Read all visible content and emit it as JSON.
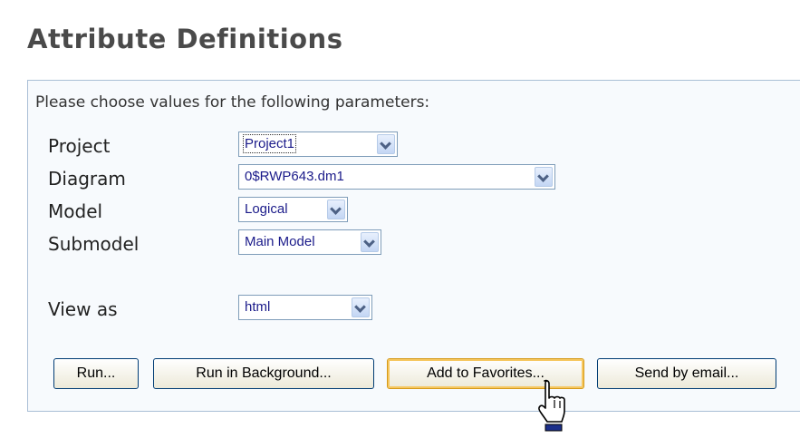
{
  "page": {
    "title": "Attribute Definitions"
  },
  "form": {
    "intro": "Please choose values for the following parameters:",
    "fields": {
      "project": {
        "label": "Project",
        "value": "Project1"
      },
      "diagram": {
        "label": "Diagram",
        "value": "0$RWP643.dm1"
      },
      "model": {
        "label": "Model",
        "value": "Logical"
      },
      "submodel": {
        "label": "Submodel",
        "value": "Main Model"
      },
      "view_as": {
        "label": "View as",
        "value": "html"
      }
    }
  },
  "buttons": {
    "run": "Run...",
    "run_background": "Run in Background...",
    "add_favorites": "Add to Favorites...",
    "send_email": "Send by email..."
  },
  "icons": {
    "dropdown": "chevron-down-icon",
    "cursor": "hand-pointer-icon"
  },
  "colors": {
    "accent_border": "#a9bfd6",
    "select_text": "#1b1b8a",
    "hover_border": "#f6c760"
  }
}
